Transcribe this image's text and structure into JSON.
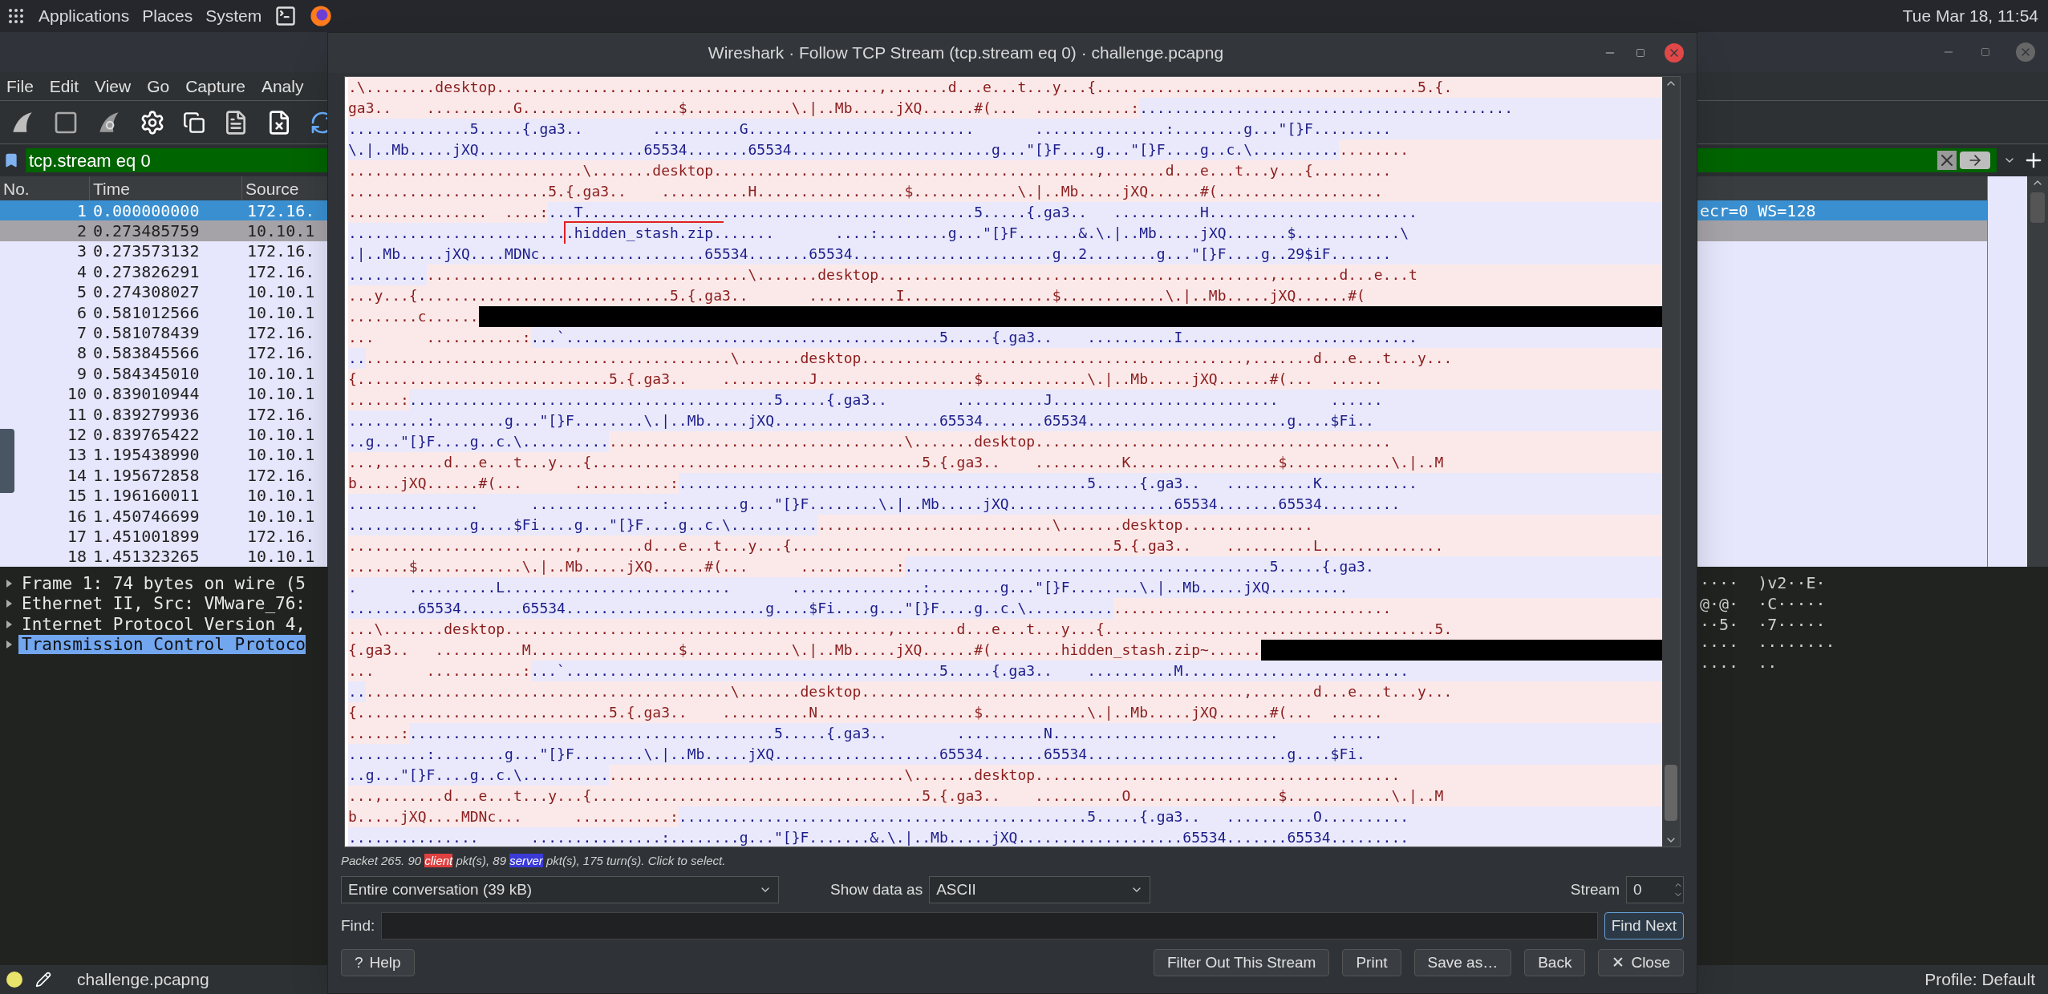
{
  "top_panel": {
    "menus": [
      "Applications",
      "Places",
      "System"
    ],
    "clock": "Tue Mar 18, 11:54"
  },
  "main_window": {
    "menu": [
      "File",
      "Edit",
      "View",
      "Go",
      "Capture",
      "Analy"
    ],
    "filter": {
      "value": "tcp.stream eq 0"
    },
    "packet_list": {
      "columns": [
        "No.",
        "Time",
        "Source"
      ],
      "rows": [
        {
          "no": "1",
          "time": "0.000000000",
          "source": "172.16.",
          "info": "ecr=0 WS=128",
          "selected": true,
          "hovered": false
        },
        {
          "no": "2",
          "time": "0.273485759",
          "source": "10.10.1",
          "selected": false,
          "hovered": true
        },
        {
          "no": "3",
          "time": "0.273573132",
          "source": "172.16.",
          "selected": false,
          "hovered": false
        },
        {
          "no": "4",
          "time": "0.273826291",
          "source": "172.16.",
          "selected": false,
          "hovered": false
        },
        {
          "no": "5",
          "time": "0.274308027",
          "source": "10.10.1",
          "selected": false,
          "hovered": false
        },
        {
          "no": "6",
          "time": "0.581012566",
          "source": "10.10.1",
          "selected": false,
          "hovered": false
        },
        {
          "no": "7",
          "time": "0.581078439",
          "source": "172.16.",
          "selected": false,
          "hovered": false
        },
        {
          "no": "8",
          "time": "0.583845566",
          "source": "172.16.",
          "selected": false,
          "hovered": false
        },
        {
          "no": "9",
          "time": "0.584345010",
          "source": "10.10.1",
          "selected": false,
          "hovered": false
        },
        {
          "no": "10",
          "time": "0.839010944",
          "source": "10.10.1",
          "selected": false,
          "hovered": false
        },
        {
          "no": "11",
          "time": "0.839279936",
          "source": "172.16.",
          "selected": false,
          "hovered": false
        },
        {
          "no": "12",
          "time": "0.839765422",
          "source": "10.10.1",
          "selected": false,
          "hovered": false
        },
        {
          "no": "13",
          "time": "1.195438990",
          "source": "10.10.1",
          "selected": false,
          "hovered": false
        },
        {
          "no": "14",
          "time": "1.195672858",
          "source": "172.16.",
          "selected": false,
          "hovered": false
        },
        {
          "no": "15",
          "time": "1.196160011",
          "source": "10.10.1",
          "selected": false,
          "hovered": false
        },
        {
          "no": "16",
          "time": "1.450746699",
          "source": "10.10.1",
          "selected": false,
          "hovered": false
        },
        {
          "no": "17",
          "time": "1.451001899",
          "source": "172.16.",
          "selected": false,
          "hovered": false
        },
        {
          "no": "18",
          "time": "1.451323265",
          "source": "10.10.1",
          "selected": false,
          "hovered": false
        }
      ]
    },
    "details": [
      {
        "text": "Frame 1: 74 bytes on wire (5",
        "selected": false,
        "expanded": false
      },
      {
        "text": "Ethernet II, Src: VMware_76:",
        "selected": false,
        "expanded": false
      },
      {
        "text": "Internet Protocol Version 4,",
        "selected": false,
        "expanded": false
      },
      {
        "text": "Transmission Control Protoco",
        "selected": true,
        "expanded": false
      }
    ],
    "bytes": [
      "····  )v2··E·",
      "@·@·  ·C·····",
      "··5·  ·7·····",
      "····  ········",
      "····  ··"
    ],
    "status": {
      "file": "challenge.pcapng",
      "profile": "Profile: Default"
    }
  },
  "dialog": {
    "title": "Wireshark · Follow TCP Stream (tcp.stream eq 0) · challenge.pcapng",
    "stream": [
      [
        {
          "kind": "client",
          "text": ".\\........desktop............................................,.......d...e...t...y...{.....................................5.{."
        }
      ],
      [
        {
          "kind": "client",
          "text": "ga3..    ..........G..................$............\\.|..Mb.....jXQ......#(...  ...........:"
        },
        {
          "kind": "server",
          "text": "..........................................."
        }
      ],
      [
        {
          "kind": "server",
          "text": "..............5.....{.ga3..        ..........G..........................       ...............:........g...\"[}F........."
        }
      ],
      [
        {
          "kind": "server",
          "text": "\\.|..Mb.....jXQ...................65534.......65534.......................g...\"[}F....g...\"[}F....g..c.\\.........."
        },
        {
          "kind": "client",
          "text": "........"
        }
      ],
      [
        {
          "kind": "client",
          "text": "...........................\\.......desktop............................................,.......d...e...t...y...{........."
        }
      ],
      [
        {
          "kind": "client",
          "text": ".......................5.{.ga3..    ..........H.................$............\\.|..Mb.....jXQ......#(..................."
        }
      ],
      [
        {
          "kind": "client",
          "text": "................  ....:"
        },
        {
          "kind": "server",
          "text": "...T.............................................5.....{.ga3..   ..........H........................"
        }
      ],
      [
        {
          "kind": "server",
          "text": "........................."
        },
        {
          "kind": "marked",
          "text": ".hidden_stash.zip."
        },
        {
          "kind": "server",
          "text": "......       ....:........g...\"[}F.......&.\\.|..Mb.....jXQ.......$............\\"
        }
      ],
      [
        {
          "kind": "server",
          "text": ".|..Mb.....jXQ....MDNc...................65534.......65534.......................g..2........g...\"[}F....g..29$iF......."
        }
      ],
      [
        {
          "kind": "server",
          "text": "........."
        },
        {
          "kind": "client",
          "text": ".....................................\\.......desktop.............................................,.......d...e...t"
        }
      ],
      [
        {
          "kind": "client",
          "text": "...y...{.............................5.{.ga3..       ..........I.................$............\\.|..Mb.....jXQ......#("
        }
      ],
      [
        {
          "kind": "client",
          "text": "........c......"
        },
        {
          "kind": "redacted"
        }
      ],
      [
        {
          "kind": "client",
          "text": "...      ...........:"
        },
        {
          "kind": "server",
          "text": "...`...........................................5.....{.ga3..    ..........I..........................."
        }
      ],
      [
        {
          "kind": "server",
          "text": ".."
        },
        {
          "kind": "client",
          "text": "..........................................\\.......desktop............................................,.......d...e...t...y..."
        }
      ],
      [
        {
          "kind": "client",
          "text": "{.............................5.{.ga3..    ..........J..................$............\\.|..Mb.....jXQ......#(...  ......"
        }
      ],
      [
        {
          "kind": "client",
          "text": "......:"
        },
        {
          "kind": "server",
          "text": "..........................................5.....{.ga3..        ..........J..........................      ......"
        }
      ],
      [
        {
          "kind": "server",
          "text": ".........:........g...\"[}F........\\.|..Mb.....jXQ...................65534.......65534.......................g....$Fi.."
        }
      ],
      [
        {
          "kind": "server",
          "text": "..g...\"[}F....g..c.\\.........."
        },
        {
          "kind": "client",
          "text": "..................................\\.......desktop........................................."
        }
      ],
      [
        {
          "kind": "client",
          "text": "...,.......d...e...t...y...{......................................5.{.ga3..    ..........K.................$............\\.|..M"
        }
      ],
      [
        {
          "kind": "client",
          "text": "b.....jXQ......#(...      ...........:"
        },
        {
          "kind": "server",
          "text": "...............................................5.....{.ga3..   ..........K..........."
        }
      ],
      [
        {
          "kind": "server",
          "text": "...............      ...............:........g...\"[}F........\\.|..Mb.....jXQ...................65534.......65534........."
        }
      ],
      [
        {
          "kind": "server",
          "text": "..............g....$Fi....g...\"[}F....g..c.\\.........."
        },
        {
          "kind": "client",
          "text": "...........................\\.......desktop..............."
        }
      ],
      [
        {
          "kind": "client",
          "text": "..........................,.......d...e...t...y...{.....................................5.{.ga3..    ..........L.............."
        }
      ],
      [
        {
          "kind": "client",
          "text": ".......$............\\.|..Mb.....jXQ......#(...      ...........:"
        },
        {
          "kind": "server",
          "text": "..........................................5.....{.ga3."
        }
      ],
      [
        {
          "kind": "server",
          "text": ".      ..........L..........................       ...............:........g...\"[}F........\\.|..Mb.....jXQ........."
        }
      ],
      [
        {
          "kind": "server",
          "text": "........65534.......65534.......................g....$Fi....g...\"[}F....g..c.\\.........."
        },
        {
          "kind": "client",
          "text": "................................"
        }
      ],
      [
        {
          "kind": "client",
          "text": "...\\.......desktop............................................,.......d...e...t...y...{......................................5."
        }
      ],
      [
        {
          "kind": "client",
          "text": "{.ga3..   ..........M.................$............\\.|..Mb.....jXQ......#(........hidden_stash.zip~......"
        },
        {
          "kind": "redacted"
        }
      ],
      [
        {
          "kind": "client",
          "text": "...      ...........:"
        },
        {
          "kind": "server",
          "text": "...`...........................................5.....{.ga3..    ..........M.........................."
        }
      ],
      [
        {
          "kind": "server",
          "text": ".."
        },
        {
          "kind": "client",
          "text": "..........................................\\.......desktop............................................,.......d...e...t...y..."
        }
      ],
      [
        {
          "kind": "client",
          "text": "{.............................5.{.ga3..    ..........N..................$............\\.|..Mb.....jXQ......#(...  ......"
        }
      ],
      [
        {
          "kind": "client",
          "text": "......:"
        },
        {
          "kind": "server",
          "text": "..........................................5.....{.ga3..        ..........N..........................      ......"
        }
      ],
      [
        {
          "kind": "server",
          "text": ".........:........g...\"[}F........\\.|..Mb.....jXQ...................65534.......65534.......................g....$Fi."
        }
      ],
      [
        {
          "kind": "server",
          "text": "..g...\"[}F....g..c.\\.........."
        },
        {
          "kind": "client",
          "text": "..................................\\.......desktop.........................................."
        }
      ],
      [
        {
          "kind": "client",
          "text": "...,.......d...e...t...y...{......................................5.{.ga3..    ..........O.................$............\\.|..M"
        }
      ],
      [
        {
          "kind": "client",
          "text": "b.....jXQ....MDNc...      ...........:"
        },
        {
          "kind": "server",
          "text": "...............................................5.....{.ga3..   ..........O.........."
        }
      ],
      [
        {
          "kind": "server",
          "text": "...............      ...............:........g...\"[}F.......&.\\.|..Mb.....jXQ...................65534.......65534........."
        }
      ]
    ],
    "info": [
      {
        "kind": "plain",
        "text": "Packet 265. 90 "
      },
      {
        "kind": "client",
        "text": "client"
      },
      {
        "kind": "plain",
        "text": " pkt(s), 89 "
      },
      {
        "kind": "server",
        "text": "server"
      },
      {
        "kind": "plain",
        "text": " pkt(s), 175 turn(s). Click to select."
      }
    ],
    "conversation_select": "Entire conversation (39 kB)",
    "show_data_label": "Show data as",
    "show_data_select": "ASCII",
    "stream_label": "Stream",
    "stream_value": "0",
    "find_label": "Find:",
    "find_button": "Find Next",
    "buttons": [
      {
        "label": "Help",
        "icon": "?",
        "kind": "left"
      },
      {
        "label": "Filter Out This Stream",
        "kind": "right"
      },
      {
        "label": "Print",
        "kind": "right"
      },
      {
        "label": "Save as…",
        "kind": "right"
      },
      {
        "label": "Back",
        "kind": "right"
      },
      {
        "label": "Close",
        "icon": "✕",
        "kind": "right"
      }
    ]
  }
}
